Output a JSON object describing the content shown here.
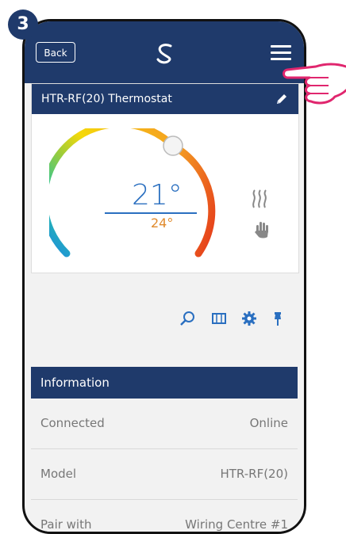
{
  "step_number": "3",
  "topbar": {
    "back_label": "Back",
    "logo_icon": "salus-logo-icon",
    "menu_icon": "hamburger-menu-icon",
    "color": "#1f3a6b"
  },
  "device": {
    "title": "HTR-RF(20) Thermostat",
    "edit_icon": "pencil-icon",
    "current_temp": "21°",
    "set_temp": "24°",
    "mode_icons": [
      "heating-waves-icon",
      "manual-hand-icon"
    ],
    "tool_icons": [
      "search-zoom-icon",
      "schedule-film-icon",
      "settings-gear-icon",
      "pin-icon"
    ]
  },
  "information": {
    "header": "Information",
    "rows": [
      {
        "key": "Connected",
        "value": "Online"
      },
      {
        "key": "Model",
        "value": "HTR-RF(20)"
      },
      {
        "key": "Pair with",
        "value": "Wiring Centre #1"
      }
    ]
  },
  "colors": {
    "accent": "#2a6fc0",
    "setpoint": "#e08a2c",
    "pointer": "#e0266e"
  }
}
